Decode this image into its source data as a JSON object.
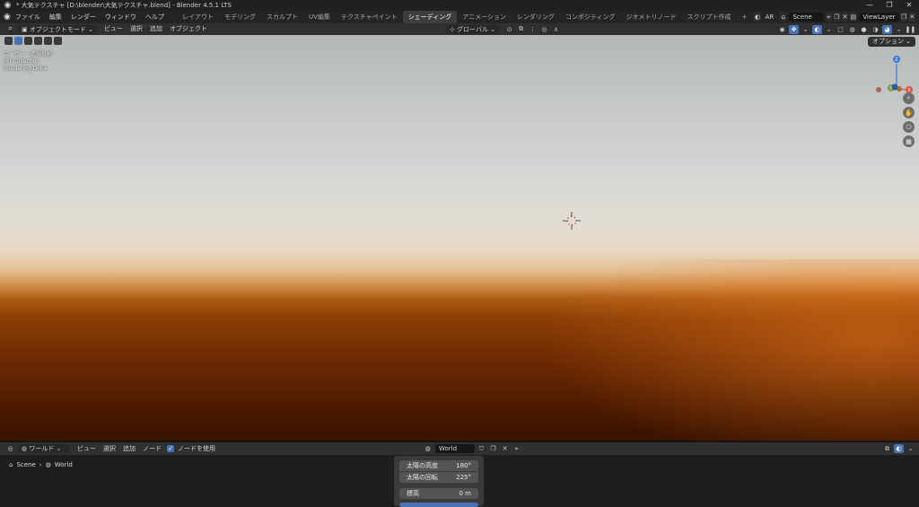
{
  "titlebar": {
    "title": "* 大気テクスチャ [D:\\blender\\大気テクスチャ.blend] - Blender 4.5.1 LTS",
    "minimize": "—",
    "maximize": "❐",
    "close": "✕"
  },
  "menubar": {
    "menus": [
      "ファイル",
      "編集",
      "レンダー",
      "ウィンドウ",
      "ヘルプ"
    ],
    "workspaces": [
      "レイアウト",
      "モデリング",
      "スカルプト",
      "UV編集",
      "テクスチャペイント",
      "シェーディング",
      "アニメーション",
      "レンダリング",
      "コンポジティング",
      "ジオメトリノード",
      "スクリプト作成"
    ],
    "active_workspace": "シェーディング",
    "add_tab": "+",
    "ar_label": "AR",
    "scene": "Scene",
    "view_layer": "ViewLayer"
  },
  "viewport_header": {
    "mode": "オブジェクトモード",
    "menus": [
      "ビュー",
      "選択",
      "追加",
      "オブジェクト"
    ],
    "transform_orientation": "グローバル",
    "options": "オプション"
  },
  "viewport": {
    "overlay_lines": [
      "ユーザー・透視投影",
      "(4) Collection",
      "Rendering Done"
    ],
    "gizmo_axes": {
      "z": "Z",
      "y": "Y",
      "x": "X"
    }
  },
  "node_header": {
    "editor_type": "ワールド",
    "menus": [
      "ビュー",
      "選択",
      "追加",
      "ノード"
    ],
    "use_nodes_label": "ノードを使用",
    "use_nodes_checked": true,
    "world_name": "World"
  },
  "node_editor": {
    "breadcrumb": [
      "Scene",
      "World"
    ],
    "panel_rows": [
      {
        "label": "太陽の高度",
        "value": "180°"
      },
      {
        "label": "太陽の回転",
        "value": "225°"
      },
      {
        "label": "標高",
        "value": "0 m"
      }
    ]
  },
  "colors": {
    "accent": "#4772b3",
    "sky_top": "#b3b8b7",
    "horizon": "#e4bf93",
    "ground": "#8c3e05",
    "axis_x": "#e0543f",
    "axis_y": "#7ea33c",
    "axis_z": "#3c78d8"
  }
}
